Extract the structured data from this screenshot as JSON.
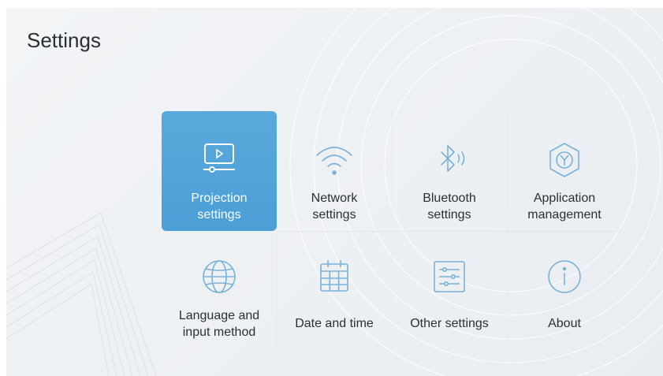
{
  "header": {
    "title": "Settings"
  },
  "tiles": [
    {
      "label": "Projection\nsettings",
      "icon": "projection-icon",
      "selected": true
    },
    {
      "label": "Network\nsettings",
      "icon": "wifi-icon",
      "selected": false
    },
    {
      "label": "Bluetooth\nsettings",
      "icon": "bluetooth-icon",
      "selected": false
    },
    {
      "label": "Application\nmanagement",
      "icon": "app-hexagon-icon",
      "selected": false
    },
    {
      "label": "Language and\ninput method",
      "icon": "globe-icon",
      "selected": false
    },
    {
      "label": "Date and time",
      "icon": "calendar-icon",
      "selected": false
    },
    {
      "label": "Other settings",
      "icon": "sliders-icon",
      "selected": false
    },
    {
      "label": "About",
      "icon": "info-icon",
      "selected": false
    }
  ],
  "colors": {
    "accent": "#4b9fd6",
    "icon_stroke": "#4a90c8",
    "text": "#2b2f33",
    "background": "#eef1f4"
  }
}
